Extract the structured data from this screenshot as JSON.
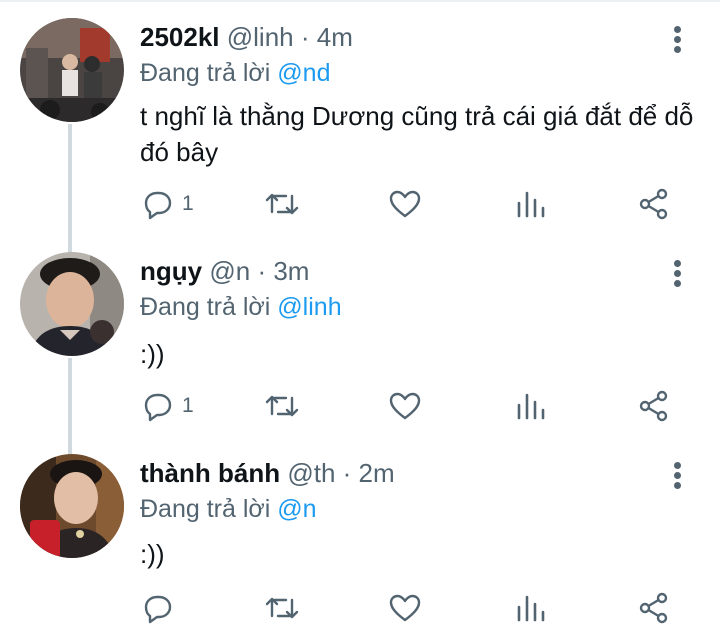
{
  "colors": {
    "link": "#1d9bf0",
    "muted": "#536471",
    "thread_line": "#cfd9de"
  },
  "icons": {
    "reply": "comment-bubble-icon",
    "retweet": "retweet-icon",
    "like": "heart-icon",
    "views": "bar-chart-icon",
    "share": "share-icon",
    "more": "more-vertical-icon"
  },
  "tweets": [
    {
      "name": "2502kl",
      "handle": "@linh",
      "sep": "·",
      "time": "4m",
      "replying_prefix": "Đang trả lời",
      "replying_to": "@nd",
      "text": "t nghĩ là thằng Dương cũng trả cái giá đắt để dỗ đó bây",
      "reply_count": "1"
    },
    {
      "name": "ngụy",
      "handle": "@n",
      "sep": "·",
      "time": "3m",
      "replying_prefix": "Đang trả lời",
      "replying_to": "@linh",
      "text": ":))",
      "reply_count": "1"
    },
    {
      "name": "thành bánh",
      "handle": "@th",
      "sep": "·",
      "time": "2m",
      "replying_prefix": "Đang trả lời",
      "replying_to": "@n",
      "text": ":))",
      "reply_count": ""
    }
  ]
}
